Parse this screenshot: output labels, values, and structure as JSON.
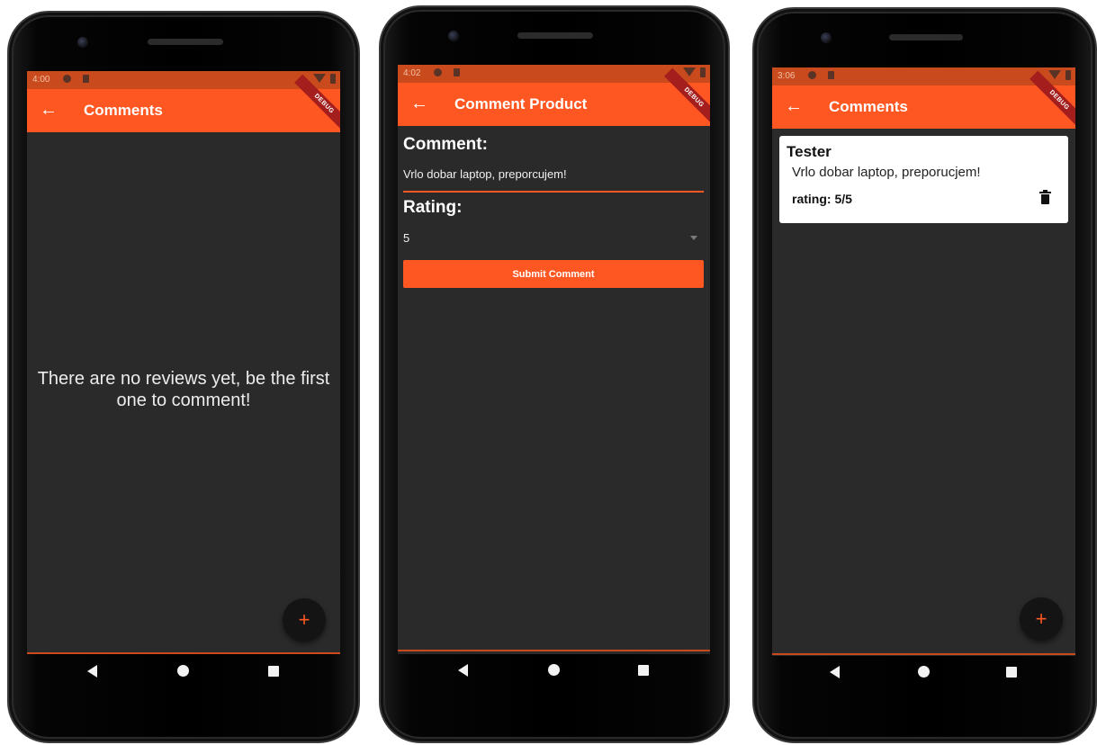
{
  "colors": {
    "accent": "#ff5722",
    "status_bar": "#c94a1c",
    "screen_bg": "#2a2a2a",
    "fab_bg": "#141414",
    "debug_banner": "#a41e1e"
  },
  "debug_banner": "DEBUG",
  "screens": [
    {
      "status_time": "4:00",
      "app_title": "Comments",
      "back_icon": "arrow-left-icon",
      "empty_message": "There are no reviews yet, be the first one to comment!",
      "fab_label": "+"
    },
    {
      "status_time": "4:02",
      "app_title": "Comment Product",
      "back_icon": "arrow-left-icon",
      "comment_label": "Comment:",
      "comment_value": "Vrlo dobar laptop, preporcujem!",
      "rating_label": "Rating:",
      "rating_value": "5",
      "submit_label": "Submit Comment"
    },
    {
      "status_time": "3:06",
      "app_title": "Comments",
      "back_icon": "arrow-left-icon",
      "comment": {
        "author": "Tester",
        "text": "Vrlo dobar laptop, preporucjem!",
        "rating": "rating: 5/5",
        "delete_icon": "trash-icon"
      },
      "fab_label": "+"
    }
  ],
  "navbar_icons": [
    "back-triangle-icon",
    "home-circle-icon",
    "recents-square-icon"
  ]
}
